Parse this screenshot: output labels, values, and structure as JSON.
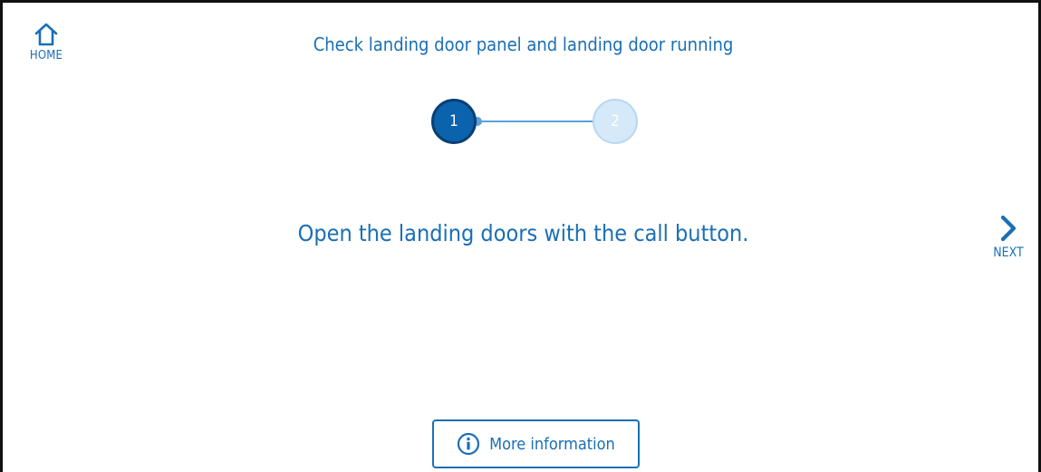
{
  "header": {
    "home_label": "HOME",
    "title": "Check landing door panel and landing door running"
  },
  "stepper": {
    "current_step": 1,
    "steps": [
      {
        "label": "1",
        "state": "active"
      },
      {
        "label": "2",
        "state": "upcoming"
      }
    ]
  },
  "main": {
    "instruction": "Open the landing doors with the call button."
  },
  "navigation": {
    "next_label": "NEXT"
  },
  "footer": {
    "more_info_label": "More information"
  },
  "icons": {
    "home": "home-icon",
    "next": "chevron-right-icon",
    "info": "info-icon"
  },
  "colors": {
    "accent": "#1a6fb5",
    "step_active": "#0b63ad",
    "step_active_border": "#0a3f73",
    "step_upcoming": "#d5e9f8",
    "connector": "#5aa2d8"
  }
}
